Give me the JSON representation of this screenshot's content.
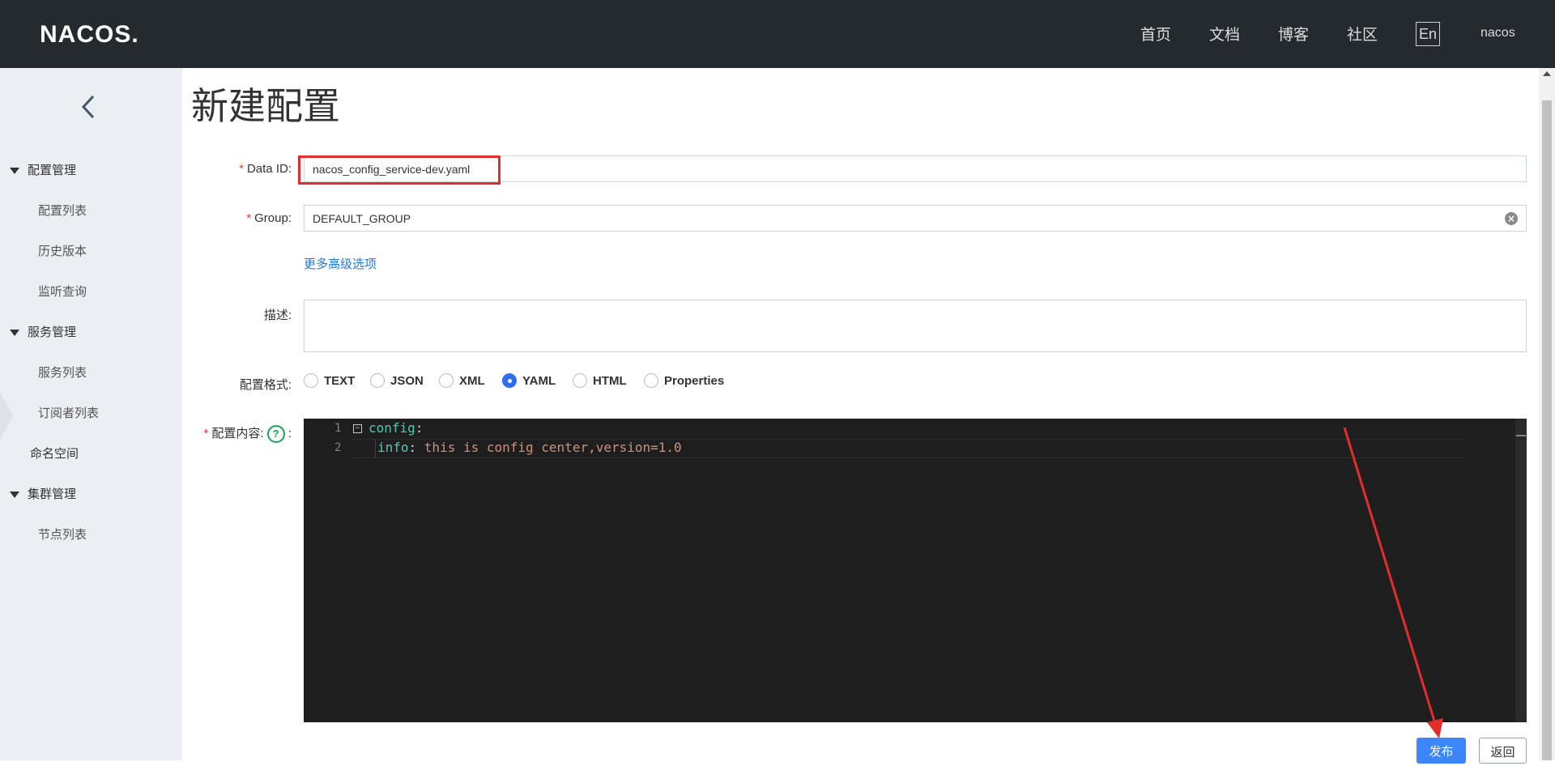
{
  "header": {
    "logo": "NACOS.",
    "nav": [
      "首页",
      "文档",
      "博客",
      "社区"
    ],
    "lang": "En",
    "user": "nacos"
  },
  "sidebar": {
    "groups": [
      {
        "label": "配置管理",
        "items": [
          "配置列表",
          "历史版本",
          "监听查询"
        ]
      },
      {
        "label": "服务管理",
        "items": [
          "服务列表",
          "订阅者列表"
        ]
      },
      {
        "label": "命名空间",
        "items": []
      },
      {
        "label": "集群管理",
        "items": [
          "节点列表"
        ]
      }
    ]
  },
  "main": {
    "title": "新建配置",
    "form": {
      "data_id_label": "Data ID:",
      "data_id_value": "nacos_config_service-dev.yaml",
      "group_label": "Group:",
      "group_value": "DEFAULT_GROUP",
      "advanced_link": "更多高级选项",
      "desc_label": "描述:",
      "format_label": "配置格式:",
      "formats": [
        "TEXT",
        "JSON",
        "XML",
        "YAML",
        "HTML",
        "Properties"
      ],
      "selected_format": "YAML",
      "content_label": "配置内容:",
      "content_colon": ":",
      "required_mark": "*"
    },
    "editor": {
      "lines": [
        {
          "num": "1",
          "key": "config",
          "sep": ":",
          "value": ""
        },
        {
          "num": "2",
          "key": "info",
          "sep": ": ",
          "value": "this is config center,version=1.0"
        }
      ]
    },
    "buttons": {
      "publish": "发布",
      "back": "返回"
    }
  },
  "colors": {
    "header_bg": "#252a2f",
    "sidebar_bg": "#ebeef2",
    "primary": "#3c86ff",
    "link": "#2478dc",
    "required": "#e73c3c",
    "annotation": "#e32d2d"
  }
}
